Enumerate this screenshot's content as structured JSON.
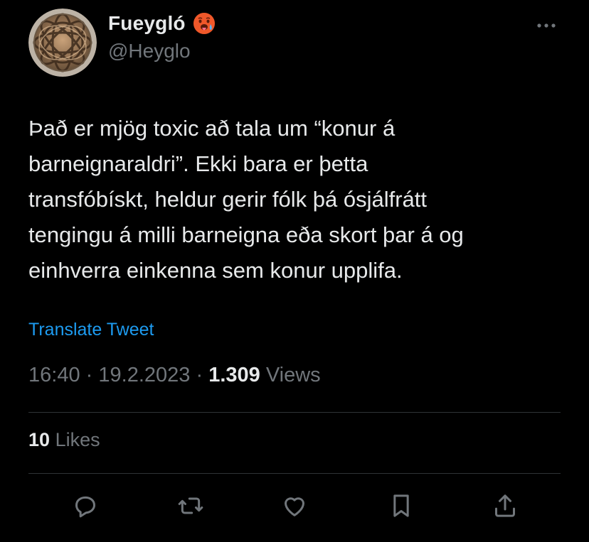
{
  "author": {
    "display_name": "Fueygló",
    "handle": "@Heyglo",
    "avatar_icon": "woven-sphere-avatar",
    "name_emoji": "hot-face-emoji"
  },
  "tweet": {
    "text": "Það er mjög toxic að tala um “konur á\nbarneignaraldri”. Ekki bara er þetta\ntransfóbískt, heldur gerir fólk þá ósjálfrátt\ntengingu á milli barneigna eða skort þar á og\neinhverra einkenna sem konur upplifa.",
    "translate_label": "Translate Tweet",
    "time": "16:40",
    "date": "19.2.2023",
    "separator": "·",
    "views_count": "1.309",
    "views_label": "Views"
  },
  "engagement": {
    "likes_count": "10",
    "likes_label": "Likes"
  },
  "actions": [
    "reply",
    "retweet",
    "like",
    "bookmark",
    "share"
  ],
  "colors": {
    "background": "#000000",
    "primary_text": "#e7e9ea",
    "secondary_text": "#71767b",
    "link": "#1d9bf0",
    "divider": "#2f3336"
  }
}
